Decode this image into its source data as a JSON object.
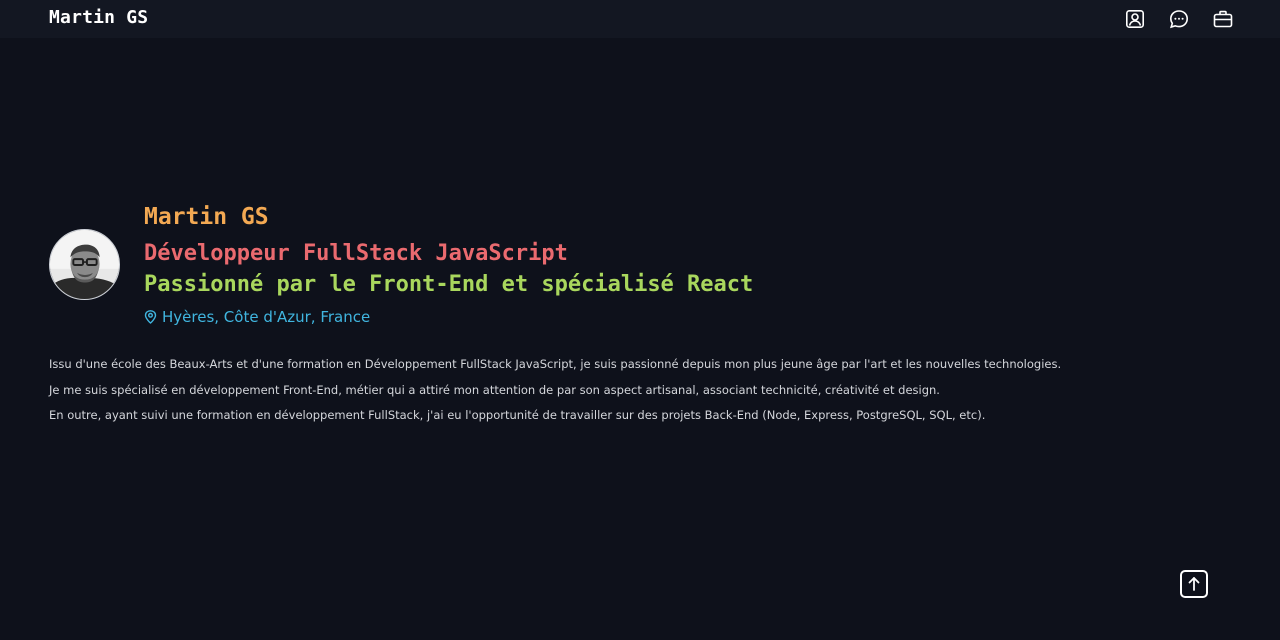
{
  "navbar": {
    "brand": "Martin GS",
    "icons": [
      "user-profile-icon",
      "chat-bubble-icon",
      "briefcase-icon"
    ]
  },
  "hero": {
    "name": "Martin GS",
    "role": "Développeur FullStack JavaScript",
    "tagline": "Passionné par le Front-End et spécialisé React",
    "location": "Hyères, Côte d'Azur, France",
    "location_icon": "map-pin-icon",
    "avatar": "profile-photo"
  },
  "bio": {
    "paragraphs": [
      "Issu d'une école des Beaux-Arts et d'une formation en Développement FullStack JavaScript, je suis passionné depuis mon plus jeune âge par l'art et les nouvelles technologies.",
      "Je me suis spécialisé en développement Front-End, métier qui a attiré mon attention de par son aspect artisanal, associant technicité, créativité et design.",
      "En outre, ayant suivi une formation en développement FullStack, j'ai eu l'opportunité de travailler sur des projets Back-End (Node, Express, PostgreSQL, SQL, etc)."
    ]
  },
  "scroll_top": {
    "icon": "arrow-up-icon"
  },
  "colors": {
    "background": "#0e111b",
    "navbar": "#131722",
    "name": "#f3a953",
    "role": "#ea6a6f",
    "tagline": "#a9d75d",
    "location": "#40b5df"
  }
}
